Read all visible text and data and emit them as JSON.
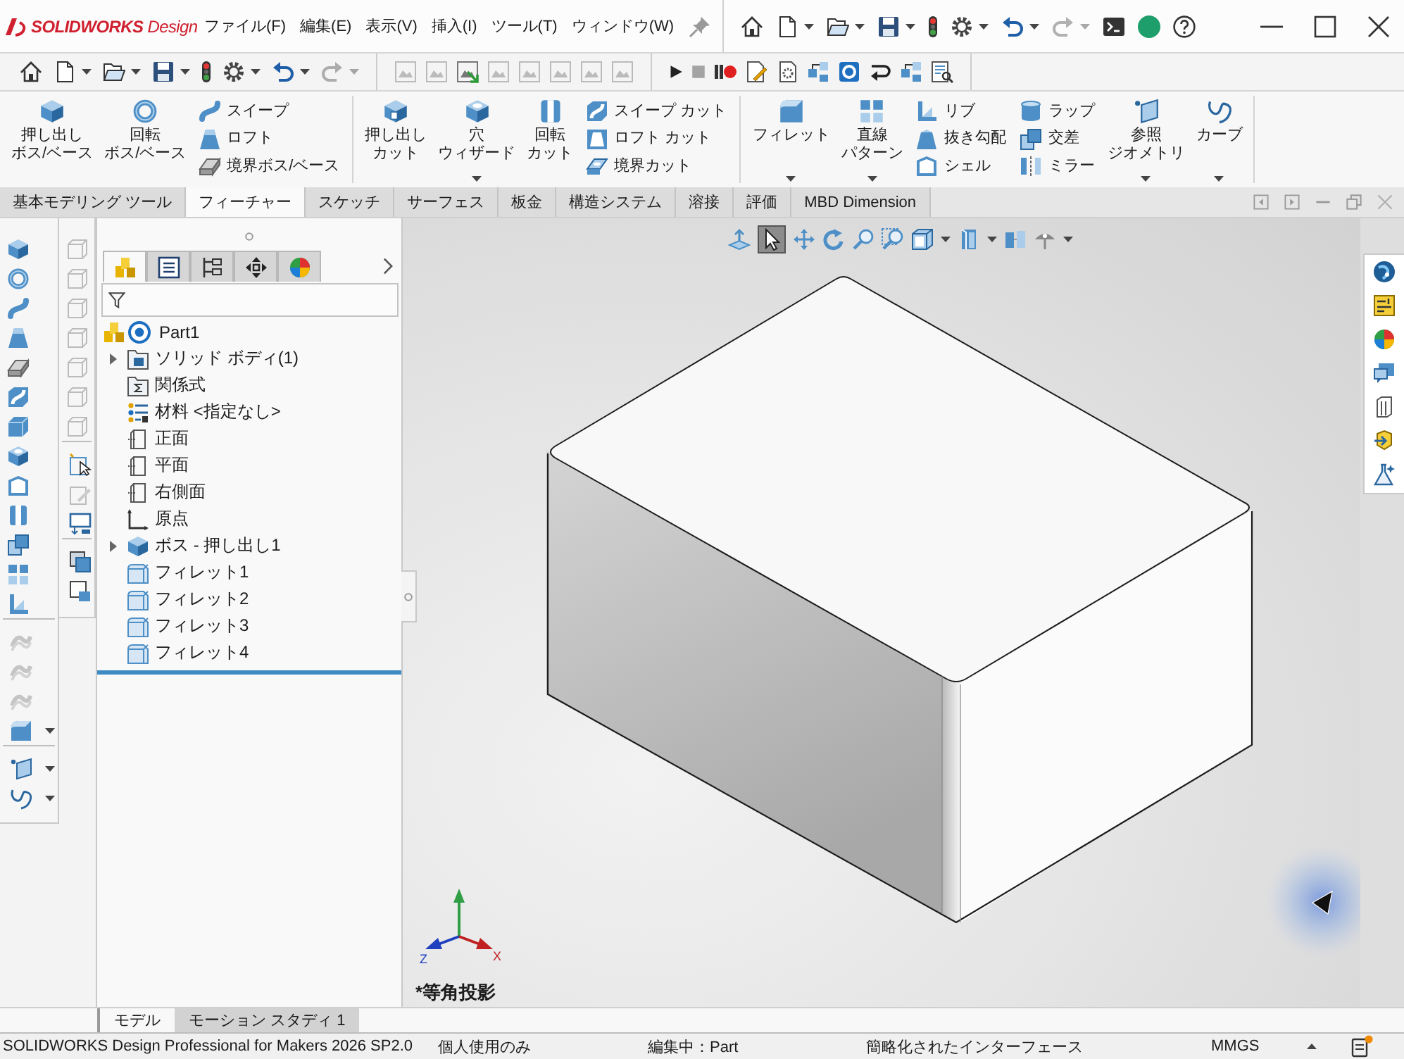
{
  "title_bar": {
    "logo": "**SOLIDWORKS** Design",
    "menus": [
      "ファイル(F)",
      "編集(E)",
      "表示(V)",
      "挿入(I)",
      "ツール(T)",
      "ウィンドウ(W)"
    ],
    "tools": [
      {
        "kind": "home",
        "dropdown": false,
        "disabled": false
      },
      {
        "kind": "document",
        "dropdown": true,
        "disabled": false
      },
      {
        "kind": "folder",
        "dropdown": true,
        "disabled": false
      },
      {
        "kind": "save",
        "dropdown": true,
        "disabled": false
      },
      {
        "kind": "light",
        "dropdown": false,
        "disabled": false
      },
      {
        "kind": "gear",
        "dropdown": true,
        "disabled": false
      },
      {
        "kind": "undo",
        "dropdown": true,
        "disabled": false
      },
      {
        "kind": "redo",
        "dropdown": true,
        "disabled": true
      },
      {
        "kind": "terminal",
        "dropdown": false,
        "disabled": false
      },
      {
        "kind": "avatar",
        "dropdown": false,
        "disabled": false
      },
      {
        "kind": "help",
        "dropdown": false,
        "disabled": false
      }
    ]
  },
  "toolbar": [
    [
      {
        "kind": "home",
        "dropdown": false,
        "disabled": false
      },
      {
        "kind": "document",
        "dropdown": true,
        "disabled": false
      },
      {
        "kind": "folder",
        "dropdown": true,
        "disabled": false
      },
      {
        "kind": "save",
        "dropdown": true,
        "disabled": false
      },
      {
        "kind": "light",
        "dropdown": false,
        "disabled": false
      },
      {
        "kind": "gear",
        "dropdown": true,
        "disabled": false
      },
      {
        "kind": "undo",
        "dropdown": true,
        "disabled": false
      },
      {
        "kind": "redo",
        "dropdown": true,
        "disabled": true
      }
    ],
    [
      {
        "kind": "frame",
        "disabled": true
      },
      {
        "kind": "frame",
        "disabled": true
      },
      {
        "kind": "frame-arrow",
        "disabled": false
      },
      {
        "kind": "frame",
        "disabled": true
      },
      {
        "kind": "frame",
        "disabled": true
      },
      {
        "kind": "frame",
        "disabled": true
      },
      {
        "kind": "frame",
        "disabled": true
      },
      {
        "kind": "frame",
        "disabled": true
      }
    ],
    [
      {
        "kind": "play",
        "disabled": false
      },
      {
        "kind": "stop",
        "disabled": true
      },
      {
        "kind": "record",
        "disabled": false
      },
      {
        "kind": "page-pencil",
        "disabled": false
      },
      {
        "kind": "page-gear",
        "disabled": false
      },
      {
        "kind": "linked",
        "disabled": false
      },
      {
        "kind": "badge",
        "disabled": false
      },
      {
        "kind": "hook",
        "disabled": false
      },
      {
        "kind": "linked",
        "disabled": false
      },
      {
        "kind": "page-search",
        "disabled": false
      }
    ]
  ],
  "ribbon": [
    {
      "columns": [
        {
          "kind": "large",
          "items": [
            {
              "kind": "cube",
              "label": "押し出しボス/ベース",
              "dropdown": false
            }
          ]
        },
        {
          "kind": "large",
          "items": [
            {
              "kind": "ring",
              "label": "回転ボス/ベース",
              "dropdown": false
            }
          ]
        },
        {
          "kind": "small",
          "items": [
            {
              "kind": "tube",
              "label": "スイープ"
            },
            {
              "kind": "tapered",
              "label": "ロフト"
            },
            {
              "kind": "plate",
              "label": "境界ボス/ベース"
            }
          ]
        }
      ]
    },
    {
      "columns": [
        {
          "kind": "large",
          "items": [
            {
              "kind": "cut",
              "label": "押し出しカット",
              "dropdown": false
            }
          ]
        },
        {
          "kind": "large",
          "items": [
            {
              "kind": "drilled",
              "label": "穴ウィザード",
              "dropdown": true
            }
          ]
        },
        {
          "kind": "large",
          "items": [
            {
              "kind": "hollow",
              "label": "回転カット",
              "dropdown": false
            }
          ]
        },
        {
          "kind": "small",
          "items": [
            {
              "kind": "tube-cut",
              "label": "スイープ カット"
            },
            {
              "kind": "tapered-cut",
              "label": "ロフト カット"
            },
            {
              "kind": "plate-cut",
              "label": "境界カット"
            }
          ]
        }
      ]
    },
    {
      "columns": [
        {
          "kind": "large",
          "items": [
            {
              "kind": "fillet",
              "label": "フィレット",
              "dropdown": true
            }
          ]
        },
        {
          "kind": "large",
          "items": [
            {
              "kind": "pattern",
              "label": "直線パターン",
              "dropdown": true
            }
          ]
        },
        {
          "kind": "small",
          "items": [
            {
              "kind": "rib",
              "label": "リブ"
            },
            {
              "kind": "draft",
              "label": "抜き勾配"
            },
            {
              "kind": "shell",
              "label": "シェル"
            }
          ]
        },
        {
          "kind": "small",
          "items": [
            {
              "kind": "wrap",
              "label": "ラップ"
            },
            {
              "kind": "intersect",
              "label": "交差"
            },
            {
              "kind": "mirror",
              "label": "ミラー"
            }
          ]
        },
        {
          "kind": "large",
          "items": [
            {
              "kind": "plane",
              "label": "参照ジオメトリ",
              "dropdown": true
            }
          ]
        },
        {
          "kind": "large",
          "items": [
            {
              "kind": "curve",
              "label": "カーブ",
              "dropdown": true
            }
          ]
        }
      ]
    }
  ],
  "tabs": [
    {
      "label": "基本モデリング ツール",
      "selected": false
    },
    {
      "label": "フィーチャー",
      "selected": true
    },
    {
      "label": "スケッチ",
      "selected": false
    },
    {
      "label": "サーフェス",
      "selected": false
    },
    {
      "label": "板金",
      "selected": false
    },
    {
      "label": "構造システム",
      "selected": false
    },
    {
      "label": "溶接",
      "selected": false
    },
    {
      "label": "評価",
      "selected": false
    },
    {
      "label": "MBD Dimension",
      "selected": false
    }
  ],
  "feature_toolbar": [
    [
      {
        "kind": "cube"
      },
      {
        "kind": "ring"
      },
      {
        "kind": "tube"
      },
      {
        "kind": "tapered"
      },
      {
        "kind": "plate"
      },
      {
        "kind": "tube-cut"
      },
      {
        "kind": "slab"
      },
      {
        "kind": "drilled"
      },
      {
        "kind": "shell"
      },
      {
        "kind": "hollow"
      },
      {
        "kind": "intersect"
      },
      {
        "kind": "pattern"
      },
      {
        "kind": "rib"
      }
    ],
    [
      {
        "kind": "twist",
        "disabled": true,
        "dropdown": false
      },
      {
        "kind": "twist",
        "disabled": true,
        "dropdown": false
      },
      {
        "kind": "twist",
        "disabled": true,
        "dropdown": false
      },
      {
        "kind": "fillet",
        "disabled": false,
        "dropdown": true
      }
    ],
    [
      {
        "kind": "plane",
        "dropdown": true
      },
      {
        "kind": "curve",
        "dropdown": true
      }
    ]
  ],
  "sketch_toolbar": [
    [
      {
        "kind": "viewcube",
        "disabled": true
      },
      {
        "kind": "viewcube",
        "disabled": true
      },
      {
        "kind": "viewcube",
        "disabled": true
      },
      {
        "kind": "viewcube",
        "disabled": true
      },
      {
        "kind": "viewcube",
        "disabled": true
      },
      {
        "kind": "viewcube",
        "disabled": true
      },
      {
        "kind": "viewcube",
        "disabled": true
      }
    ],
    [
      {
        "kind": "select-frame",
        "disabled": false
      },
      {
        "kind": "pencil-frame",
        "disabled": true
      },
      {
        "kind": "screen",
        "disabled": false
      }
    ],
    [
      {
        "kind": "stack",
        "disabled": false
      },
      {
        "kind": "page-badge",
        "disabled": false
      }
    ]
  ],
  "feature_manager": {
    "tabs": [
      {
        "kind": "tree",
        "selected": true
      },
      {
        "kind": "list",
        "selected": false
      },
      {
        "kind": "config",
        "selected": false
      },
      {
        "kind": "crosshair",
        "selected": false
      },
      {
        "kind": "palette",
        "selected": false
      }
    ],
    "tree": {
      "label": "Part1",
      "kind": "part",
      "expandable": false,
      "children": [
        {
          "label": "ソリッド ボディ(1)",
          "kind": "bodies",
          "expandable": true
        },
        {
          "label": "関係式",
          "kind": "equations",
          "expandable": false
        },
        {
          "label": "材料 <指定なし>",
          "kind": "material",
          "expandable": false
        },
        {
          "label": "正面",
          "kind": "plane",
          "expandable": false
        },
        {
          "label": "平面",
          "kind": "plane",
          "expandable": false
        },
        {
          "label": "右側面",
          "kind": "plane",
          "expandable": false
        },
        {
          "label": "原点",
          "kind": "origin",
          "expandable": false
        },
        {
          "label": "ボス - 押し出し1",
          "kind": "feature",
          "expandable": true
        },
        {
          "label": "フィレット1",
          "kind": "fillet",
          "expandable": false
        },
        {
          "label": "フィレット2",
          "kind": "fillet",
          "expandable": false
        },
        {
          "label": "フィレット3",
          "kind": "fillet",
          "expandable": false
        },
        {
          "label": "フィレット4",
          "kind": "fillet",
          "expandable": false
        }
      ]
    }
  },
  "graphics": {
    "view_toolbar": [
      {
        "kind": "anchor",
        "selected": false,
        "dropdown": false
      },
      {
        "kind": "pointer",
        "selected": true,
        "dropdown": false
      },
      {
        "kind": "pan",
        "selected": false,
        "dropdown": false
      },
      {
        "kind": "rotate",
        "selected": false,
        "dropdown": false
      },
      {
        "kind": "zoom",
        "selected": false,
        "dropdown": false
      },
      {
        "kind": "zoom-area",
        "selected": false,
        "dropdown": false
      },
      {
        "kind": "section",
        "selected": false,
        "dropdown": true
      },
      {
        "kind": "display",
        "selected": false,
        "dropdown": true
      },
      {
        "kind": "hide",
        "selected": false,
        "dropdown": false
      },
      {
        "kind": "scene",
        "selected": false,
        "dropdown": true
      }
    ],
    "triad": {
      "z": "Z",
      "x": "X"
    },
    "view_label": "*等角投影"
  },
  "bottom_tabs": [
    {
      "label": "モデル",
      "selected": true
    },
    {
      "label": "モーション スタディ 1",
      "selected": false
    }
  ],
  "status_bar": {
    "product": "SOLIDWORKS Design Professional for Makers 2026 SP2.0",
    "license": "個人使用のみ",
    "editing": "編集中：Part",
    "interface": "簡略化されたインターフェース",
    "units": "MMGS"
  }
}
